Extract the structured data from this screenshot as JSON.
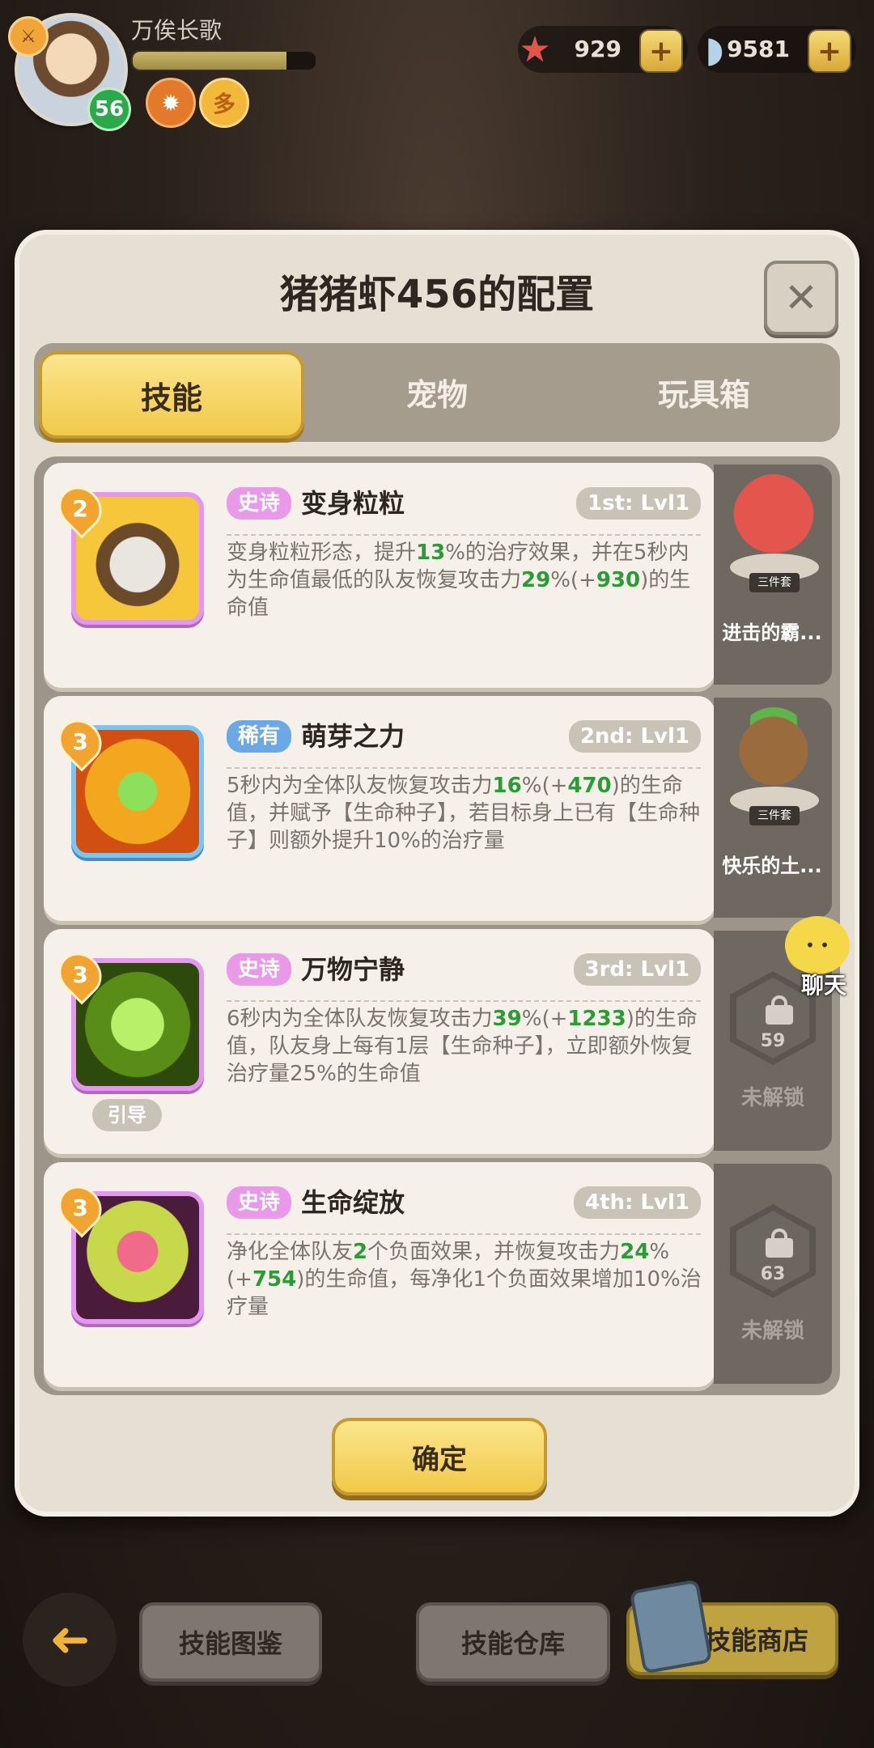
{
  "player": {
    "name": "万俟长歌",
    "level": "56",
    "exp_fraction": 0.84,
    "mini_icon_2_glyph": "多"
  },
  "currency": [
    {
      "icon": "starfish-icon",
      "value": "929",
      "plus": "+"
    },
    {
      "icon": "shell-icon",
      "value": "9581",
      "plus": "+"
    }
  ],
  "dialog": {
    "title": "猪猪虾456的配置",
    "close": "✕",
    "tabs": [
      {
        "label": "技能",
        "active": true
      },
      {
        "label": "宠物",
        "active": false
      },
      {
        "label": "玩具箱",
        "active": false
      }
    ],
    "confirm": "确定"
  },
  "skills": [
    {
      "tier": "2",
      "rarity": "史诗",
      "name": "变身粒粒",
      "slot": "1st: Lvl1",
      "desc": [
        "变身粒粒形态，提升",
        "13",
        "%的治疗效果，并在5秒内为生命值最低的队友恢复攻击力",
        "29",
        "%(+",
        "930",
        ")的生命值"
      ],
      "side": {
        "type": "pet",
        "set": "三件套",
        "name": "进击的霸..."
      }
    },
    {
      "tier": "3",
      "rarity": "稀有",
      "name": "萌芽之力",
      "slot": "2nd: Lvl1",
      "desc": [
        "5秒内为全体队友恢复攻击力",
        "16",
        "%(+",
        "470",
        ")的生命值，并赋予【生命种子】，若目标身上已有【生命种子】则额外提升10%的治疗量"
      ],
      "side": {
        "type": "pet",
        "set": "三件套",
        "name": "快乐的土..."
      }
    },
    {
      "tier": "3",
      "rarity": "史诗",
      "name": "万物宁静",
      "slot": "3rd: Lvl1",
      "tag": "引导",
      "desc": [
        "6秒内为全体队友恢复攻击力",
        "39",
        "%(+",
        "1233",
        ")的生命值，队友身上每有1层【生命种子】，立即额外恢复治疗量25%的生命值"
      ],
      "side": {
        "type": "locked",
        "level": "59",
        "text": "未解锁"
      }
    },
    {
      "tier": "3",
      "rarity": "史诗",
      "name": "生命绽放",
      "slot": "4th: Lvl1",
      "desc": [
        "净化全体队友",
        "2",
        "个负面效果，并恢复攻击力",
        "24",
        "%(+",
        "754",
        ")的生命值，每净化1个负面效果增加10%治疗量"
      ],
      "side": {
        "type": "locked",
        "level": "63",
        "text": "未解锁"
      }
    }
  ],
  "chat": {
    "label": "聊天"
  },
  "bottom": {
    "back": "➜",
    "btn1": "技能图鉴",
    "btn2": "技能仓库",
    "btn3": "技能商店"
  }
}
